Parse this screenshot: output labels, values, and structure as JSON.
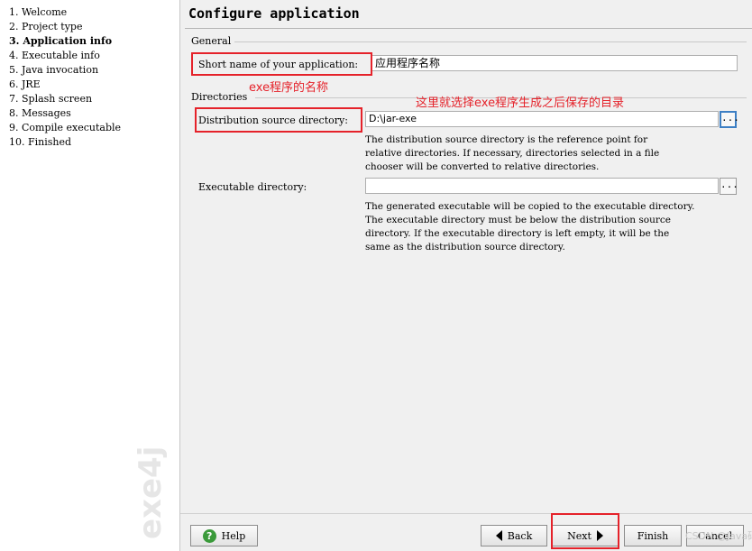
{
  "sidebar": {
    "steps": [
      {
        "label": "1. Welcome"
      },
      {
        "label": "2. Project type"
      },
      {
        "label": "3. Application info"
      },
      {
        "label": "4. Executable info"
      },
      {
        "label": "5. Java invocation"
      },
      {
        "label": "6. JRE"
      },
      {
        "label": "7. Splash screen"
      },
      {
        "label": "8. Messages"
      },
      {
        "label": "9. Compile executable"
      },
      {
        "label": "10. Finished"
      }
    ],
    "active_step": "3. Application info",
    "brand": "exe4j"
  },
  "main": {
    "title": "Configure application",
    "general": {
      "section_label": "General",
      "short_name_label": "Short name of your application:",
      "short_name_value": "应用程序名称"
    },
    "directories": {
      "section_label": "Directories",
      "dist_source_label": "Distribution source directory:",
      "dist_source_value": "D:\\jar-exe",
      "dist_source_help": "The distribution source directory is the reference point for\nrelative directories. If necessary, directories selected in a file\nchooser will be converted to relative directories.",
      "exe_dir_label": "Executable directory:",
      "exe_dir_value": "",
      "exe_dir_help": "The generated executable will be copied to the executable directory.\nThe executable directory must be below the distribution source\ndirectory. If the executable directory is left empty, it will be the\nsame as the distribution source directory.",
      "browse_label": "..."
    }
  },
  "annotations": {
    "exe_name_note": "exe程序的名称",
    "dir_note": "这里就选择exe程序生成之后保存的目录",
    "color": "#e5222a"
  },
  "buttons": {
    "help": "Help",
    "back": "Back",
    "next": "Next",
    "finish": "Finish",
    "cancel": "Cancel"
  },
  "watermark": "CSDN @Java码哥"
}
